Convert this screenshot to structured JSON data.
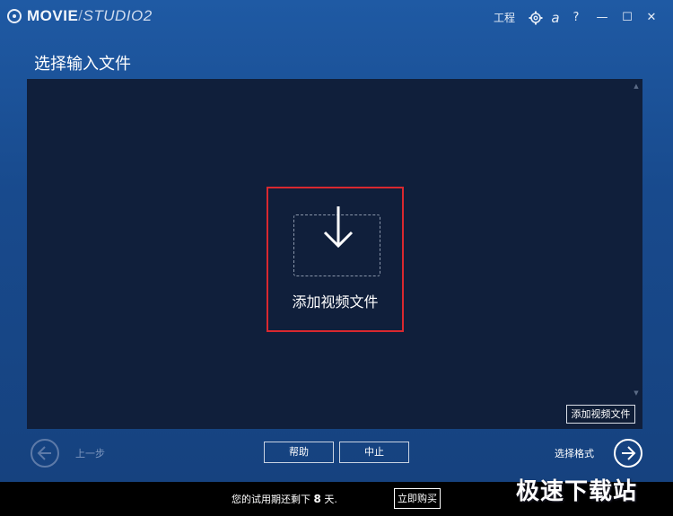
{
  "titlebar": {
    "brand_main": "MOVIE",
    "brand_sep": "/",
    "brand_sub": "STUDIO2",
    "project_label": "工程",
    "gear_icon": "gear-icon",
    "a_label": "a",
    "help_label": "?",
    "minimize_glyph": "—",
    "maximize_glyph": "☐",
    "close_glyph": "✕"
  },
  "panel": {
    "title": "选择输入文件"
  },
  "droparea": {
    "add_label": "添加视频文件",
    "small_add_label": "添加视频文件",
    "scroll_up_glyph": "▲",
    "scroll_down_glyph": "▼"
  },
  "footer": {
    "back_label": "上一步",
    "help_label": "帮助",
    "stop_label": "中止",
    "next_label": "选择格式"
  },
  "trial": {
    "text_before": "您的试用期还剩下",
    "days": "8",
    "text_after": "天.",
    "buy_label": "立即购买"
  },
  "watermark": {
    "text": "极速下载站"
  }
}
